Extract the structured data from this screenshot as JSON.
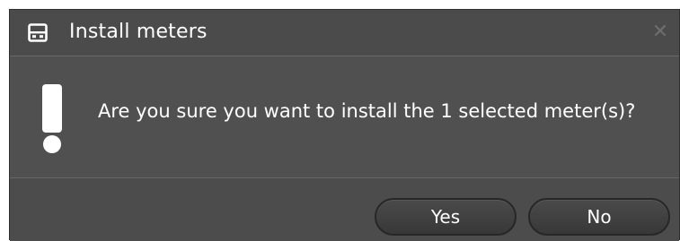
{
  "dialog": {
    "title": "Install meters",
    "title_icon": "window-icon",
    "close_glyph": "✕",
    "message": "Are you sure you want to install the 1 selected meter(s)?",
    "message_icon": "exclamation-icon"
  },
  "buttons": {
    "yes_label": "Yes",
    "no_label": "No"
  },
  "colors": {
    "dialog_bg": "#545454",
    "titlebar_bg": "#4b4b4b",
    "text": "#ffffff",
    "button_bg": "#3f3f3f"
  }
}
